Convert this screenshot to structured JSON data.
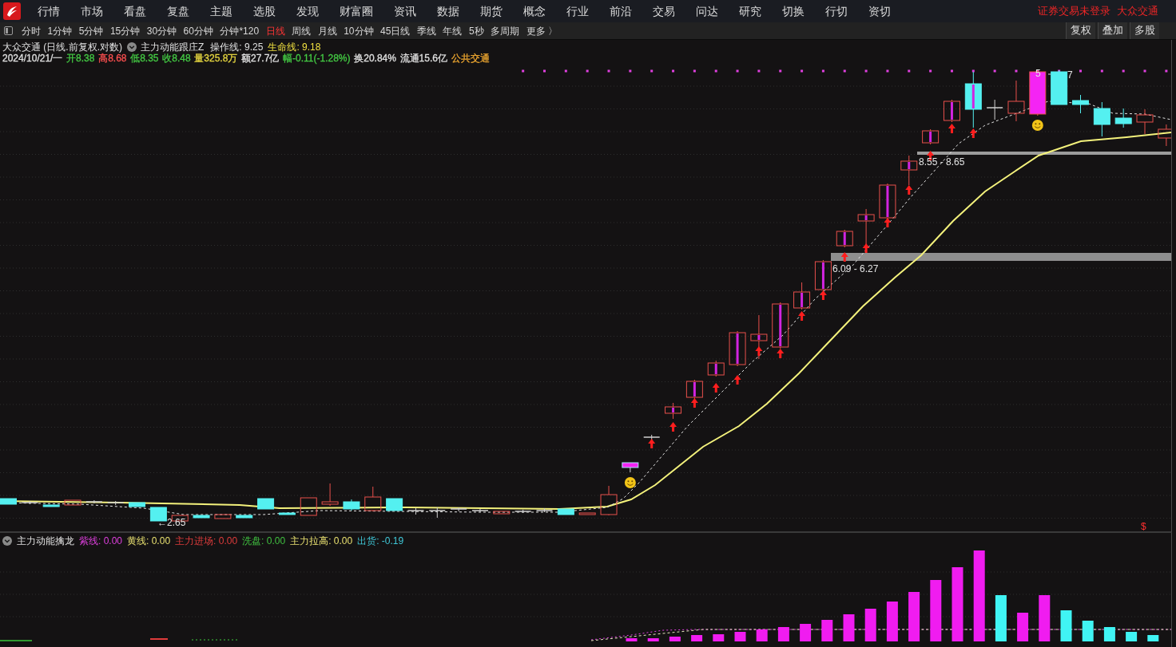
{
  "menu_bar": {
    "items": [
      "行情",
      "市场",
      "看盘",
      "复盘",
      "主题",
      "选股",
      "发现",
      "财富圈",
      "资讯",
      "数据",
      "期货",
      "概念",
      "行业",
      "前沿",
      "交易",
      "问达",
      "研究",
      "切换",
      "行切",
      "资切"
    ],
    "login_status": "证券交易未登录",
    "stock_name": "大众交通"
  },
  "period_bar": {
    "periods": [
      {
        "label": "分时",
        "selected": false
      },
      {
        "label": "1分钟",
        "selected": false
      },
      {
        "label": "5分钟",
        "selected": false
      },
      {
        "label": "15分钟",
        "selected": false
      },
      {
        "label": "30分钟",
        "selected": false
      },
      {
        "label": "60分钟",
        "selected": false
      },
      {
        "label": "分钟*120",
        "selected": false
      },
      {
        "label": "日线",
        "selected": true
      },
      {
        "label": "周线",
        "selected": false
      },
      {
        "label": "月线",
        "selected": false
      },
      {
        "label": "10分钟",
        "selected": false
      },
      {
        "label": "45日线",
        "selected": false
      },
      {
        "label": "季线",
        "selected": false
      },
      {
        "label": "年线",
        "selected": false
      },
      {
        "label": "5秒",
        "selected": false
      },
      {
        "label": "多周期",
        "selected": false
      }
    ],
    "more": "更多 〉",
    "tools": [
      "复权",
      "叠加",
      "多股"
    ]
  },
  "main_chart": {
    "title": "大众交通 (日线.前复权.对数)",
    "indicator_name": "主力动能跟庄Z",
    "indicator_values": [
      {
        "text": "操作线: 9.25",
        "color": "#e0e0e0"
      },
      {
        "text": "生命线: 9.18",
        "color": "#f0e040"
      }
    ],
    "quote": [
      {
        "text": "2024/10/21/一",
        "color": "#e0e0e0"
      },
      {
        "text": "开8.38",
        "color": "#44cc44"
      },
      {
        "text": "高8.68",
        "color": "#ff5050"
      },
      {
        "text": "低8.35",
        "color": "#44cc44"
      },
      {
        "text": "收8.48",
        "color": "#44cc44"
      },
      {
        "text": "量325.8万",
        "color": "#e8d840"
      },
      {
        "text": "额27.7亿",
        "color": "#e0e0e0"
      },
      {
        "text": "幅-0.11(-1.28%)",
        "color": "#44cc44"
      },
      {
        "text": "换20.84%",
        "color": "#e0e0e0"
      },
      {
        "text": "流通15.6亿",
        "color": "#e0e0e0"
      },
      {
        "text": "公共交通",
        "color": "#f0a830"
      }
    ],
    "price_labels": [
      "←2.65",
      "6.09 - 6.27",
      "8.55 - 8.65",
      "5",
      "7"
    ],
    "signal_mark": "$"
  },
  "indicator_panel": {
    "name": "主力动能擒龙",
    "legend": [
      {
        "text": "紫线: 0.00",
        "color": "#e040e0"
      },
      {
        "text": "黄线: 0.00",
        "color": "#e8e070"
      },
      {
        "text": "主力进场: 0.00",
        "color": "#e03c3c"
      },
      {
        "text": "洗盘: 0.00",
        "color": "#40c040"
      },
      {
        "text": "主力拉高: 0.00",
        "color": "#e8e070"
      },
      {
        "text": "出货: -0.19",
        "color": "#40c8d8"
      }
    ]
  }
}
